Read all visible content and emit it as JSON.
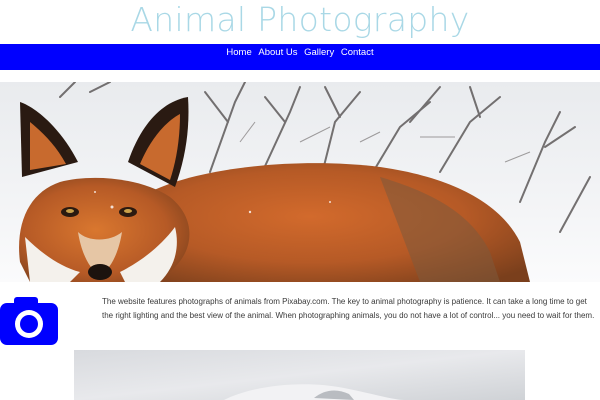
{
  "header": {
    "title": "Animal Photography",
    "title_color": "#a9d8e6"
  },
  "nav": {
    "background": "#0000ff",
    "items": [
      {
        "label": "Home"
      },
      {
        "label": "About Us"
      },
      {
        "label": "Gallery"
      },
      {
        "label": "Contact"
      }
    ]
  },
  "hero": {
    "subject": "red-fox-in-snow-photo"
  },
  "intro": {
    "icon": "camera-icon",
    "icon_color": "#0000ff",
    "text": "The website features photographs of animals from Pixabay.com. The key to animal photography is patience. It can take a long time to get the right lighting and the best view of the animal. When photographing animals, you do not have a lot of control... you need to wait for them."
  },
  "gallery": {
    "subject": "snowy-animal-photo"
  }
}
